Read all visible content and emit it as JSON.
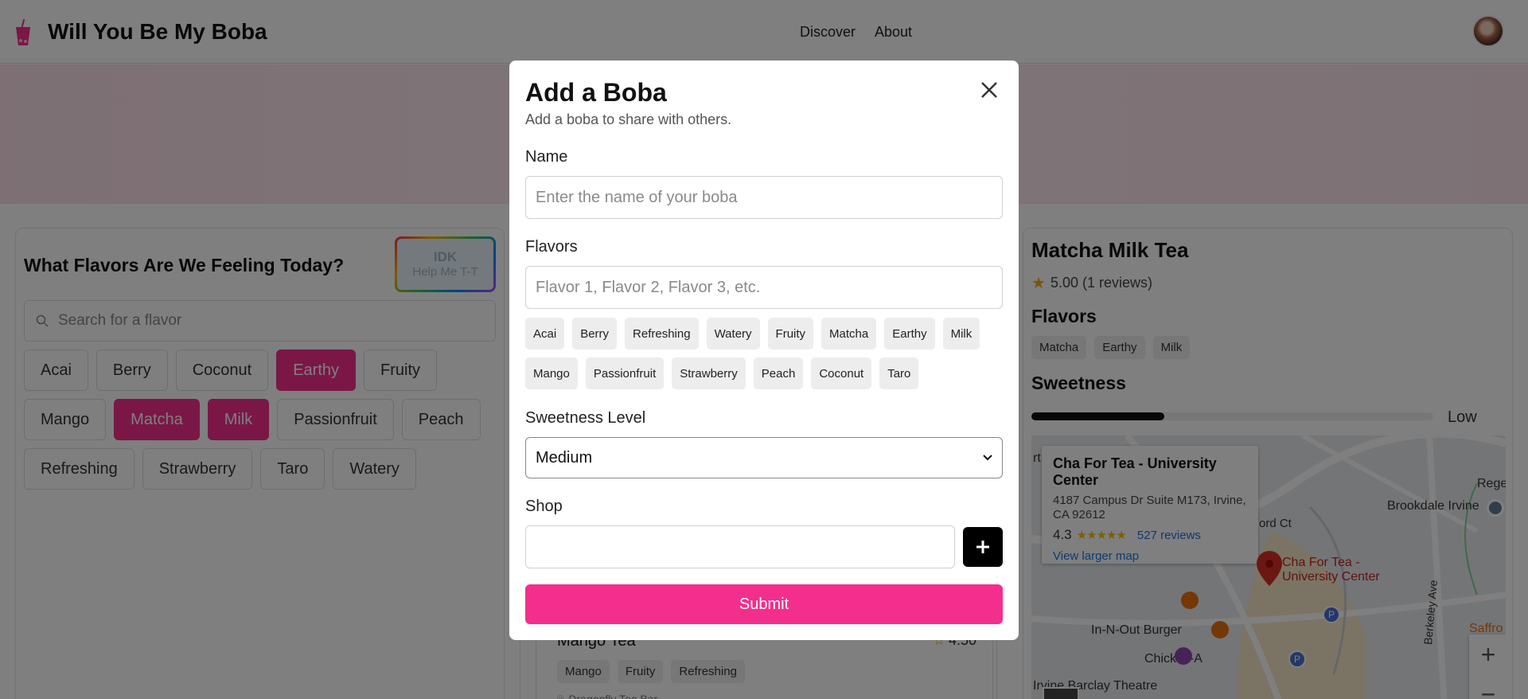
{
  "header": {
    "app_title": "Will You Be My Boba",
    "nav": [
      "Discover",
      "About"
    ]
  },
  "left_panel": {
    "title": "What Flavors Are We Feeling Today?",
    "idk_button": {
      "line1": "IDK",
      "line2": "Help Me T-T"
    },
    "search_placeholder": "Search for a flavor",
    "flavors": [
      {
        "label": "Acai",
        "selected": false
      },
      {
        "label": "Berry",
        "selected": false
      },
      {
        "label": "Coconut",
        "selected": false
      },
      {
        "label": "Earthy",
        "selected": true
      },
      {
        "label": "Fruity",
        "selected": false
      },
      {
        "label": "Mango",
        "selected": false
      },
      {
        "label": "Matcha",
        "selected": true
      },
      {
        "label": "Milk",
        "selected": true
      },
      {
        "label": "Passionfruit",
        "selected": false
      },
      {
        "label": "Peach",
        "selected": false
      },
      {
        "label": "Refreshing",
        "selected": false
      },
      {
        "label": "Strawberry",
        "selected": false
      },
      {
        "label": "Taro",
        "selected": false
      },
      {
        "label": "Watery",
        "selected": false
      }
    ]
  },
  "mid_panel": {
    "card": {
      "name": "Mango Tea",
      "rating": "4.50",
      "tags": [
        "Mango",
        "Fruity",
        "Refreshing"
      ],
      "shop": "Dragonfly Tea Bar"
    }
  },
  "right_panel": {
    "title": "Matcha Milk Tea",
    "rating": "5.00 (1 reviews)",
    "flavors_heading": "Flavors",
    "tags": [
      "Matcha",
      "Earthy",
      "Milk"
    ],
    "sweetness_heading": "Sweetness",
    "sweetness_fraction": 0.33,
    "sweetness_label": "Low",
    "map": {
      "place_name": "Cha For Tea - University Center",
      "address": "4187 Campus Dr Suite M173, Irvine, CA 92612",
      "rating": "4.3",
      "stars": "★★★★★",
      "reviews": "527 reviews",
      "larger_map": "View larger map",
      "pin_label_1": "Cha For Tea -",
      "pin_label_2": "University Center",
      "labels": {
        "brookdale": "Brookdale Irvine",
        "innout": "In-N-Out Burger",
        "chickfila": "Chick-fil-A",
        "barclay": "Irvine Barclay Theatre",
        "berkeley": "Berkeley Ave",
        "ford": "ord Ct",
        "rege": "Rege",
        "saffro": "Saffro",
        "rt": "rt"
      },
      "zoom_in": "+",
      "zoom_out": "−"
    }
  },
  "modal": {
    "title": "Add a Boba",
    "subtitle": "Add a boba to share with others.",
    "name_label": "Name",
    "name_placeholder": "Enter the name of your boba",
    "flavors_label": "Flavors",
    "flavors_placeholder": "Flavor 1, Flavor 2, Flavor 3, etc.",
    "flavor_chips": [
      "Acai",
      "Berry",
      "Refreshing",
      "Watery",
      "Fruity",
      "Matcha",
      "Earthy",
      "Milk",
      "Mango",
      "Passionfruit",
      "Strawberry",
      "Peach",
      "Coconut",
      "Taro"
    ],
    "sweetness_label": "Sweetness Level",
    "sweetness_value": "Medium",
    "shop_label": "Shop",
    "shop_value": "",
    "submit_label": "Submit"
  },
  "colors": {
    "accent": "#f42e8d",
    "overlay": "rgba(0,0,0,0.5)",
    "star": "#fbbc04",
    "link": "#1a73e8"
  }
}
